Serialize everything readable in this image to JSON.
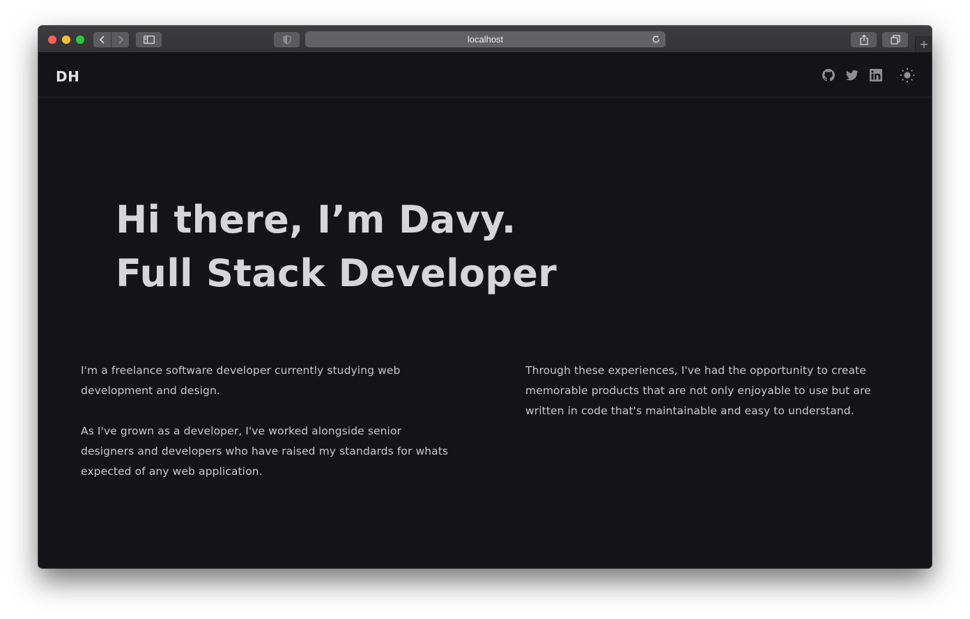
{
  "browser": {
    "url": "localhost",
    "icons": {
      "back": "chevron-left-icon",
      "forward": "chevron-right-icon",
      "sidebar": "sidebar-icon",
      "privacy": "shield-icon",
      "reload": "reload-icon",
      "share": "share-icon",
      "tabs": "tabs-overview-icon",
      "new_tab": "plus-icon"
    },
    "new_tab_label": "+"
  },
  "header": {
    "logo": "DH",
    "social": [
      {
        "name": "github",
        "icon": "github-icon"
      },
      {
        "name": "twitter",
        "icon": "twitter-icon"
      },
      {
        "name": "linkedin",
        "icon": "linkedin-icon"
      }
    ],
    "theme_toggle_icon": "sun-icon"
  },
  "hero": {
    "line1": "Hi there, I’m Davy.",
    "line2": "Full Stack Developer"
  },
  "about": {
    "left": [
      "I'm a freelance software developer currently studying web development and design.",
      "As I've grown as a developer, I've worked alongside senior designers and developers who have raised my standards for whats expected of any web application."
    ],
    "right": [
      "Through these experiences, I've had the opportunity to create memorable products that are not only enjoyable to use but are written in code that's maintainable and easy to understand."
    ]
  },
  "colors": {
    "background": "#141318",
    "text": "#c9c9cd",
    "heading": "#d6d6d9",
    "icon": "#8e8e93",
    "traffic_close": "#fe5f57",
    "traffic_minimize": "#febc2e",
    "traffic_maximize": "#28c840"
  }
}
